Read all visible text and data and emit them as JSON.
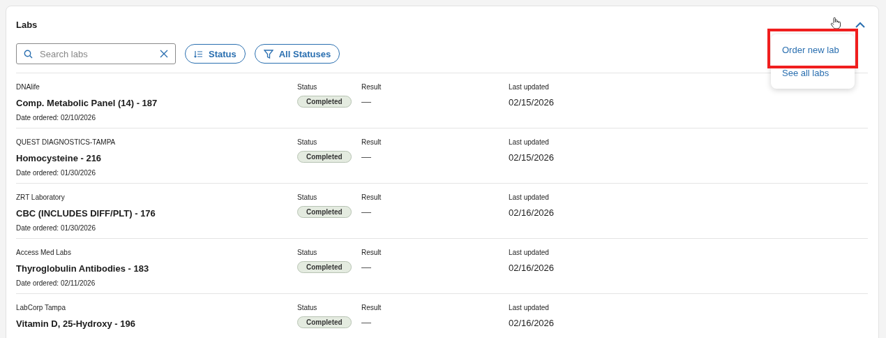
{
  "title": "Labs",
  "search": {
    "placeholder": "Search labs"
  },
  "filters": [
    {
      "kind": "sort",
      "label": "Status"
    },
    {
      "kind": "filter",
      "label": "All Statuses"
    }
  ],
  "menu": {
    "items": [
      {
        "label": "Order new lab",
        "highlighted": true
      },
      {
        "label": "See all labs",
        "highlighted": false
      }
    ]
  },
  "rows": [
    {
      "lab": "DNAlife",
      "test": "Comp. Metabolic Panel (14) - 187",
      "ordered": "Date ordered: 02/10/2026",
      "status_label": "Status",
      "status": "Completed",
      "result_label": "Result",
      "result": "—",
      "updated_label": "Last updated",
      "updated": "02/15/2026"
    },
    {
      "lab": "QUEST DIAGNOSTICS-TAMPA",
      "test": "Homocysteine - 216",
      "ordered": "Date ordered: 01/30/2026",
      "status_label": "Status",
      "status": "Completed",
      "result_label": "Result",
      "result": "—",
      "updated_label": "Last updated",
      "updated": "02/15/2026"
    },
    {
      "lab": "ZRT Laboratory",
      "test": "CBC (INCLUDES DIFF/PLT) - 176",
      "ordered": "Date ordered: 01/30/2026",
      "status_label": "Status",
      "status": "Completed",
      "result_label": "Result",
      "result": "—",
      "updated_label": "Last updated",
      "updated": "02/16/2026"
    },
    {
      "lab": "Access Med Labs",
      "test": "Thyroglobulin Antibodies - 183",
      "ordered": "Date ordered: 02/11/2026",
      "status_label": "Status",
      "status": "Completed",
      "result_label": "Result",
      "result": "—",
      "updated_label": "Last updated",
      "updated": "02/16/2026"
    },
    {
      "lab": "LabCorp Tampa",
      "test": "Vitamin D, 25-Hydroxy - 196",
      "status_label": "Status",
      "status": "Completed",
      "result_label": "Result",
      "result": "—",
      "updated_label": "Last updated",
      "updated": "02/16/2026"
    }
  ]
}
